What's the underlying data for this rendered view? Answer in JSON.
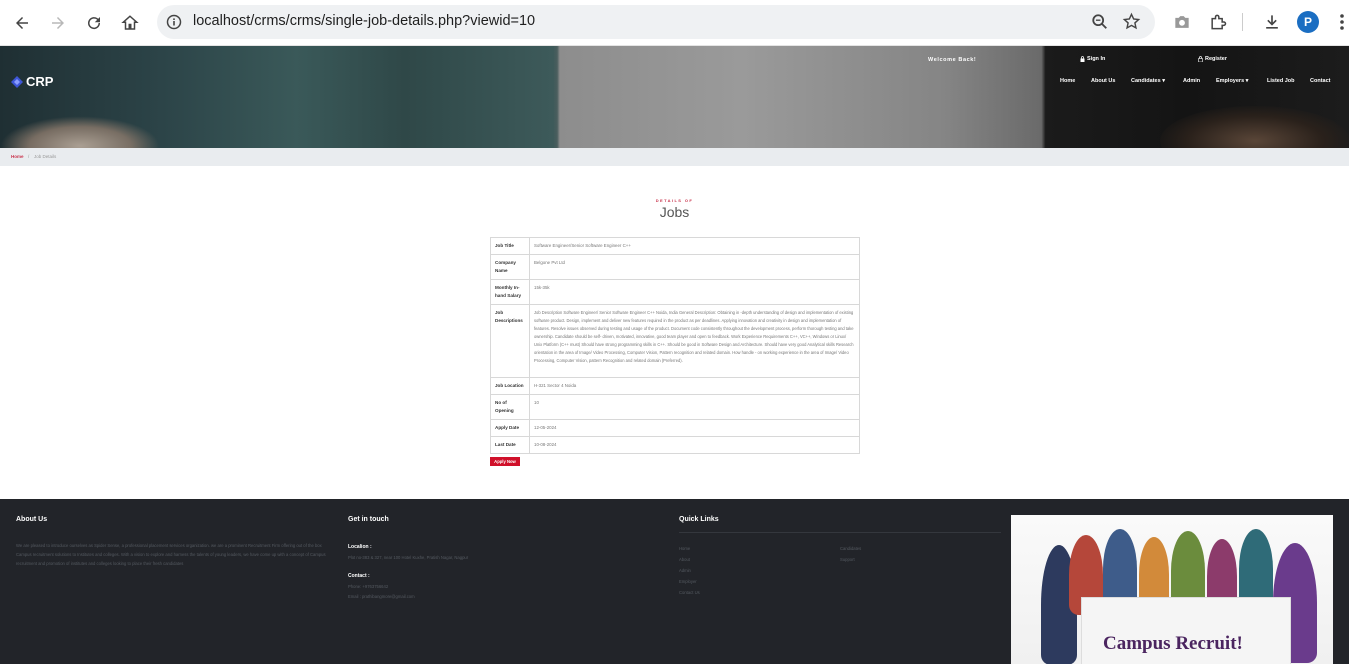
{
  "browser": {
    "url": "localhost/crms/crms/single-job-details.php?viewid=10",
    "profile_initial": "P"
  },
  "header": {
    "logo": "CRP",
    "welcome": "Welcome Back!",
    "sign_in": "Sign In",
    "register": "Register",
    "menu": [
      "Home",
      "About Us",
      "Candidates",
      "Admin",
      "Employers",
      "Listed Job",
      "Contact"
    ]
  },
  "breadcrumb": {
    "home": "Home",
    "sep": "/",
    "current": "Job Details"
  },
  "section": {
    "subtitle": "DETAILS OF",
    "title": "Jobs"
  },
  "job": {
    "rows": [
      {
        "label": "Job Title",
        "value": "Software Engineer/Senior Software Engineer C++"
      },
      {
        "label": "Company Name",
        "value": "Belgone Pvt Ltd"
      },
      {
        "label": "Monthly In-hand Salary",
        "value": "15k-35k"
      },
      {
        "label": "Job Descriptions",
        "value": "Job Description Software Engineer/ Senior Software Engineer C++ Noida, India General Description: Obtaining in -depth understanding of design and implementation of existing software product. Design, implement and deliver new features required in the product as per deadlines. Applying innovation and creativity in design and implementation of features. Resolve issues observed during testing and usage of the product. Document code consistently throughout the development process, perform thorough testing and take ownership. Candidate should be self- driven, motivated, innovative, good team player and open to feedback. Work Experience Requirements C++, VC++, Windows or Linux/ Unix Platform (C++ must) Should have strong programming skills in C++. Should be good in Software Design and Architecture. Should have very good Analytical skills Research orientation in the area of Image/ Video Processing, Computer Vision, Pattern recognition and related domain. How handle - on working experience in the area of Image/ Video Processing, Computer Vision, pattern Recognition and related domain (Preferred)."
      },
      {
        "label": "Job Location",
        "value": "H-321 Sector 4 Noida"
      },
      {
        "label": "No of Opening",
        "value": "10"
      },
      {
        "label": "Apply Date",
        "value": "12-05-2024"
      },
      {
        "label": "Last Date",
        "value": "10-08-2024"
      }
    ],
    "apply_label": "Apply Now"
  },
  "footer": {
    "about_title": "About Us",
    "about_text": "We are pleased to introduce ourselves as Spider Sense, a professional placement services organization. we are a prominent Recruitment Firm offering out of the box Campus recruitment solutions to Institutes and colleges. With a vision to explore and harness the talents of young leaders, we have come up with a concept of Campus recruitment and promotion of institutes and colleges looking to place their fresh candidates",
    "touch_title": "Get in touch",
    "location_label": "Localion :",
    "location_text": "Plot no-383 & 327, near 100 Hotel Kuxhe, Pratish Nagar, Nagpur",
    "contact_label": "Contact :",
    "phone": "Phone: +9763756642",
    "email": "Email : prathibangmore@gmail.com",
    "quick_title": "Quick Links",
    "links_col1": [
      "Home",
      "About",
      "Admin",
      "Employer",
      "Contact Us"
    ],
    "links_col2": [
      "Candidates",
      "Support"
    ],
    "banner_text": "Campus Recruit!"
  }
}
